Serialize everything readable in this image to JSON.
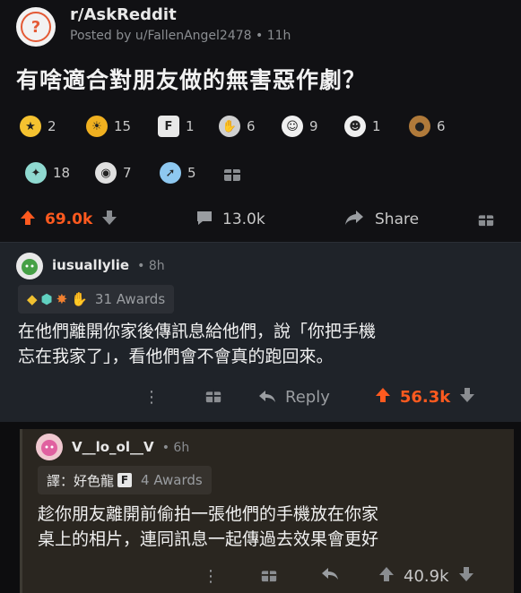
{
  "post": {
    "subreddit": "r/AskReddit",
    "posted_by": "Posted by u/FallenAngel2478 • 11h",
    "title": "有啥適合對朋友做的無害惡作劇？",
    "awards": [
      {
        "icon": "star-award-icon",
        "count": "2",
        "color": "#f5c230"
      },
      {
        "icon": "gold-award-icon",
        "count": "15",
        "color": "#f0b020"
      },
      {
        "icon": "f-award-icon",
        "count": "1",
        "color": "#e8e8e8"
      },
      {
        "icon": "clap-award-icon",
        "count": "6",
        "color": "#d0d0d0"
      },
      {
        "icon": "laugh-award-icon",
        "count": "9",
        "color": "#f0f0f0"
      },
      {
        "icon": "lol-award-icon",
        "count": "1",
        "color": "#f0f0f0"
      },
      {
        "icon": "sloth-award-icon",
        "count": "6",
        "color": "#b07a3a"
      },
      {
        "icon": "angel-award-icon",
        "count": "18",
        "color": "#8fd9d0"
      },
      {
        "icon": "snoo-award-icon",
        "count": "7",
        "color": "#e0e0e0"
      },
      {
        "icon": "rocket-award-icon",
        "count": "5",
        "color": "#8ec8f0"
      }
    ],
    "upvotes": "69.0k",
    "comments": "13.0k",
    "share_label": "Share"
  },
  "comment1": {
    "user": "iusuallylie",
    "time": "• 8h",
    "awards_label": "31 Awards",
    "text_line1": "在他們離開你家後傳訊息給他們，說「你把手機",
    "text_line2": "忘在我家了」，看他們會不會真的跑回來。",
    "reply_label": "Reply",
    "score": "56.3k"
  },
  "comment2": {
    "user": "V__lo_ol__V",
    "time": "• 6h",
    "translator_label": "譯：好色龍",
    "awards_label": "4 Awards",
    "text_line1": "趁你朋友離開前偷拍一張他們的手機放在你家",
    "text_line2": "桌上的相片，連同訊息一起傳過去效果會更好",
    "score": "40.9k"
  },
  "colors": {
    "accent": "#ff5a1f",
    "comment1_bg": "#1f2329",
    "comment2_bg": "#2a2620"
  }
}
